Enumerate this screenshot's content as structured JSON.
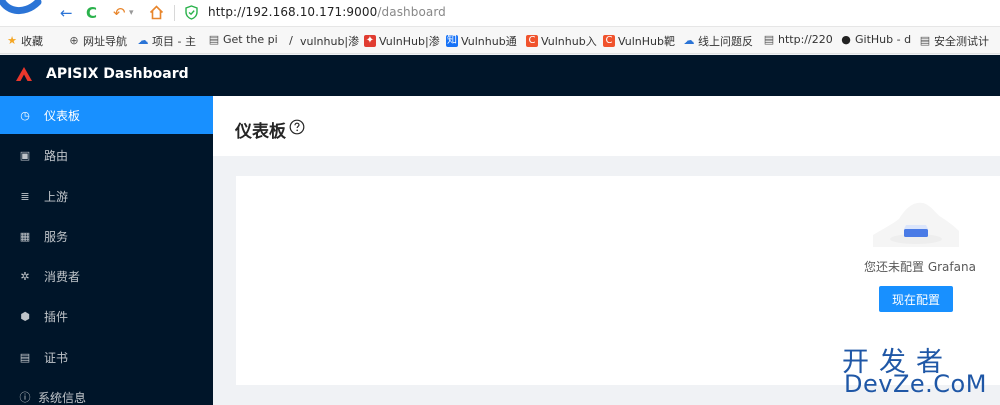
{
  "browser": {
    "url_host": "http://192.168.10.171:9000",
    "url_path": "/dashboard"
  },
  "bookmarks": [
    {
      "label": "收藏",
      "icon": "star-icon",
      "color": "#f5a623"
    },
    {
      "label": "网址导航",
      "icon": "globe-icon",
      "color": "#555555"
    },
    {
      "label": "项目 - 主",
      "icon": "cloud-icon",
      "color": "#2b74d6"
    },
    {
      "label": "Get the pi",
      "icon": "page-icon",
      "color": "#555555"
    },
    {
      "label": "vulnhub|渗",
      "icon": "vuln-icon",
      "color": "#333333"
    },
    {
      "label": "VulnHub|渗",
      "icon": "vulnhub-icon",
      "color": "#e03c31"
    },
    {
      "label": "Vulnhub通",
      "icon": "zhi-icon",
      "color": "#1772f6"
    },
    {
      "label": "Vulnhub入",
      "icon": "c-icon",
      "color": "#f0532d"
    },
    {
      "label": "VulnHub靶",
      "icon": "c-icon",
      "color": "#f0532d"
    },
    {
      "label": "线上问题反",
      "icon": "cloud-icon",
      "color": "#2b74d6"
    },
    {
      "label": "http://220",
      "icon": "page-icon",
      "color": "#555555"
    },
    {
      "label": "GitHub - d",
      "icon": "github-icon",
      "color": "#222222"
    },
    {
      "label": "安全测试计",
      "icon": "page-icon",
      "color": "#555555"
    }
  ],
  "app": {
    "title": "APISIX Dashboard",
    "brand_color": "#e8372c"
  },
  "sidebar": {
    "items": [
      {
        "label": "仪表板",
        "icon": "dashboard-icon",
        "active": true
      },
      {
        "label": "路由",
        "icon": "route-icon",
        "active": false
      },
      {
        "label": "上游",
        "icon": "upstream-icon",
        "active": false
      },
      {
        "label": "服务",
        "icon": "service-icon",
        "active": false
      },
      {
        "label": "消费者",
        "icon": "consumer-icon",
        "active": false
      },
      {
        "label": "插件",
        "icon": "plugin-icon",
        "active": false
      },
      {
        "label": "证书",
        "icon": "certificate-icon",
        "active": false
      },
      {
        "label": "系统信息",
        "icon": "info-icon",
        "active": false
      }
    ]
  },
  "main": {
    "title": "仪表板",
    "empty_text": "您还未配置 Grafana",
    "config_button": "现在配置"
  },
  "watermark": {
    "cn": "开发者",
    "en": "DevZe.CoM"
  },
  "colors": {
    "accent": "#1890ff",
    "sidebar_bg": "#001529"
  }
}
